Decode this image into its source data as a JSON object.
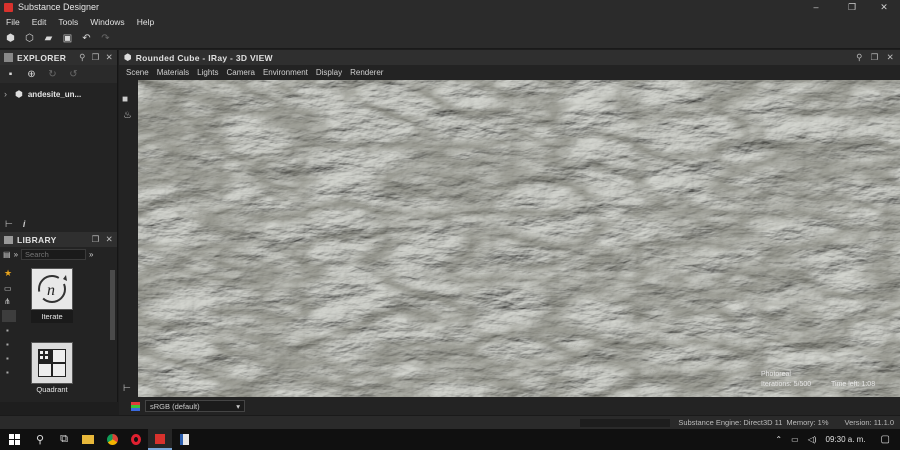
{
  "window": {
    "title": "Substance Designer",
    "controls": [
      "–",
      "❐",
      "✕"
    ]
  },
  "menu": [
    "File",
    "Edit",
    "Tools",
    "Windows",
    "Help"
  ],
  "explorer": {
    "title": "EXPLORER",
    "tree_item": "andesite_un..."
  },
  "library": {
    "title": "LIBRARY",
    "search_placeholder": "Search",
    "tiles": [
      {
        "label": "Iterate",
        "icon": "iterate-icon"
      },
      {
        "label": "Quadrant",
        "icon": "quadrant-icon"
      }
    ]
  },
  "viewport": {
    "title": "Rounded Cube - IRay - 3D VIEW",
    "menu": [
      "Scene",
      "Materials",
      "Lights",
      "Camera",
      "Environment",
      "Display",
      "Renderer"
    ],
    "overlay": {
      "line1": "Photoreal",
      "line2": "Iterations: 5/500",
      "line3": "Time left: 1:08"
    },
    "colorspace": "sRGB (default)"
  },
  "status": {
    "engine": "Substance Engine: Direct3D 11",
    "memory": "Memory: 1%",
    "version": "Version: 11.1.0"
  },
  "taskbar": {
    "time": "09:30 a. m."
  }
}
